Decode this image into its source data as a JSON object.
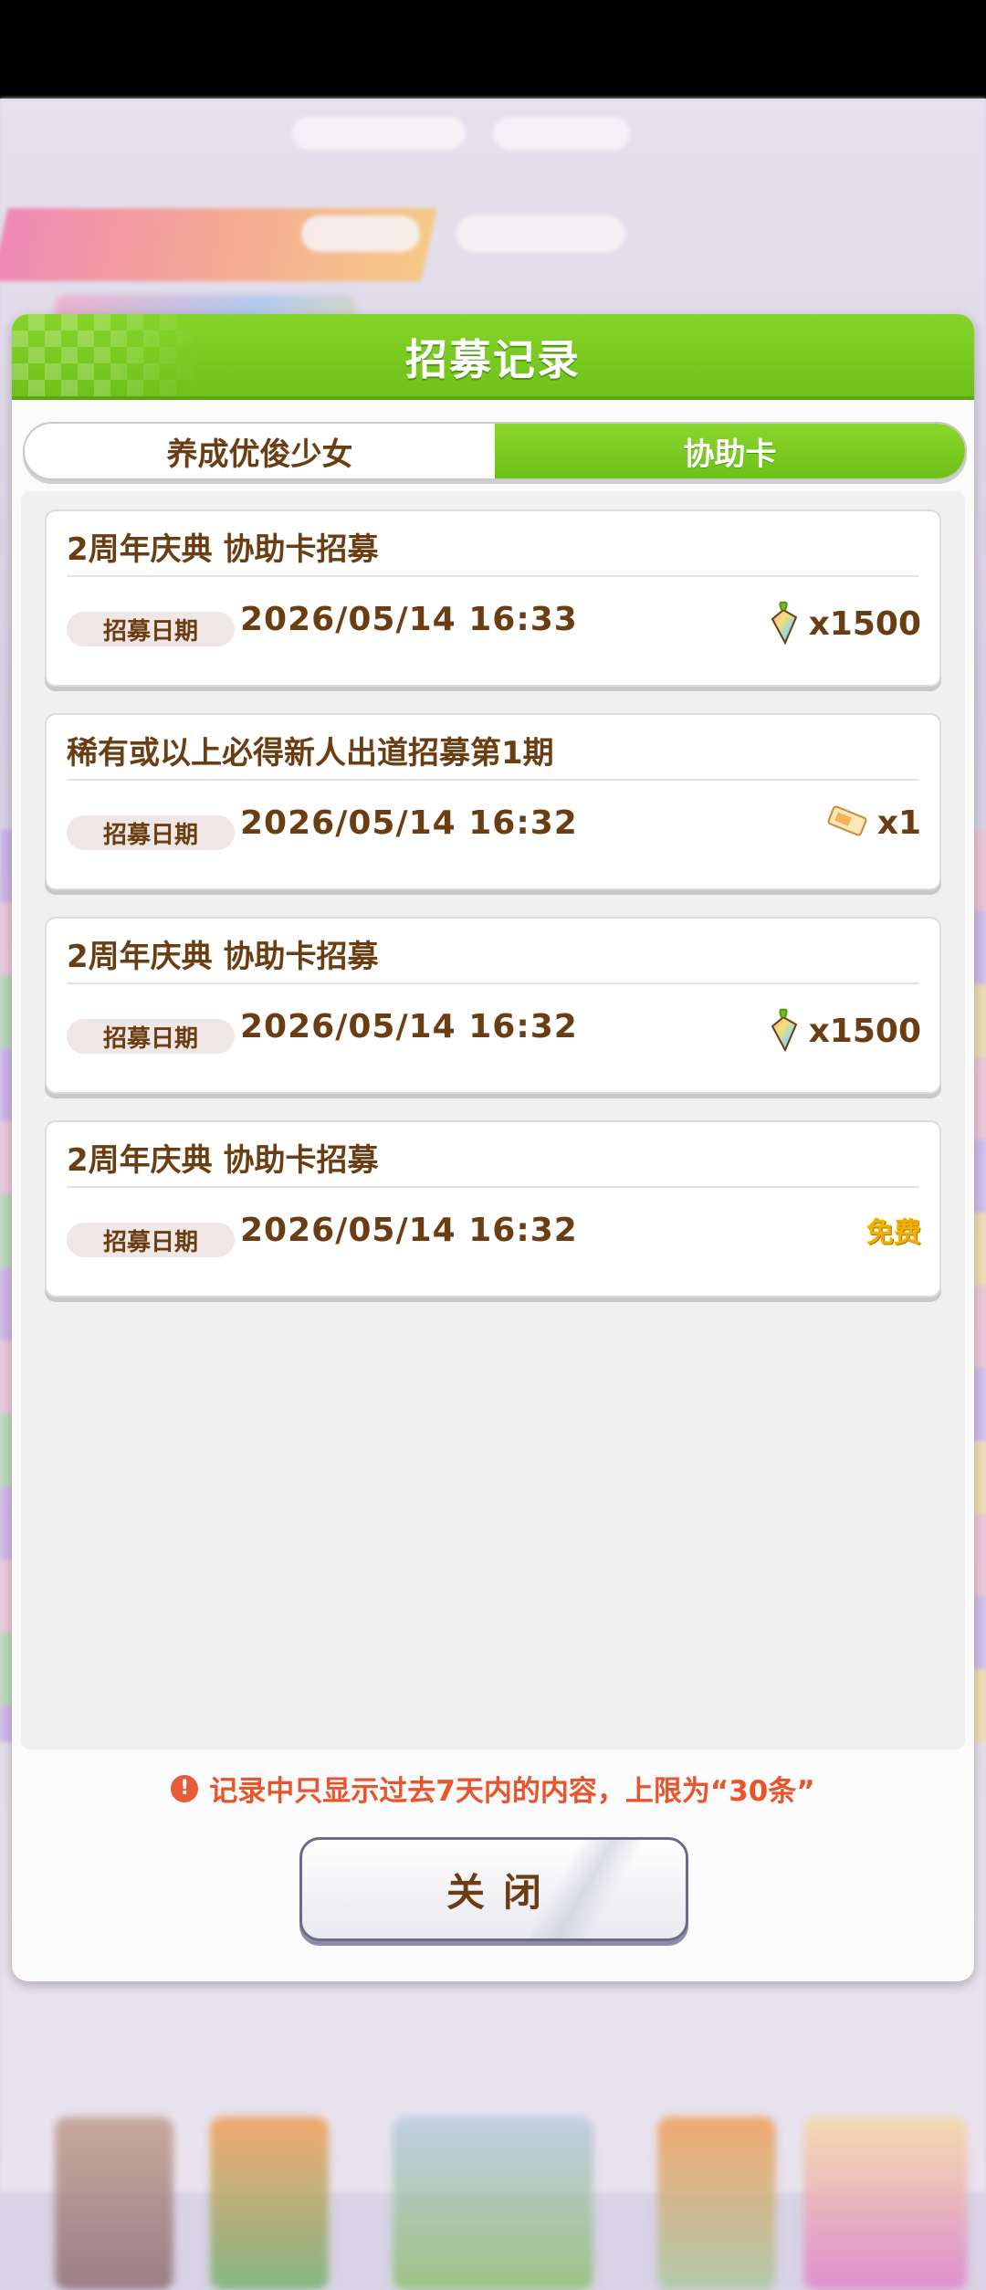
{
  "dialog": {
    "title": "招募记录",
    "tabs": [
      {
        "label": "养成优俊少女",
        "active": false
      },
      {
        "label": "协助卡",
        "active": true
      }
    ],
    "date_label": "招募日期",
    "records": [
      {
        "title": "2周年庆典  协助卡招募",
        "date": "2026/05/14  16:33",
        "cost_icon": "rainbow-carrot-icon",
        "cost": "x1500"
      },
      {
        "title": "稀有或以上必得新人出道招募第1期",
        "date": "2026/05/14  16:32",
        "cost_icon": "ticket-icon",
        "cost": "x1"
      },
      {
        "title": "2周年庆典  协助卡招募",
        "date": "2026/05/14  16:32",
        "cost_icon": "rainbow-carrot-icon",
        "cost": "x1500"
      },
      {
        "title": "2周年庆典  协助卡招募",
        "date": "2026/05/14  16:32",
        "cost_icon": "free-badge",
        "cost": "免费"
      }
    ],
    "note": "记录中只显示过去7天内的内容，上限为“30条”",
    "note_icon": "!",
    "close_label": "关闭"
  },
  "colors": {
    "header_green": "#78c81f",
    "text_brown": "#6b3d12",
    "note_red": "#e8552c",
    "free_gold": "#f0b000"
  }
}
